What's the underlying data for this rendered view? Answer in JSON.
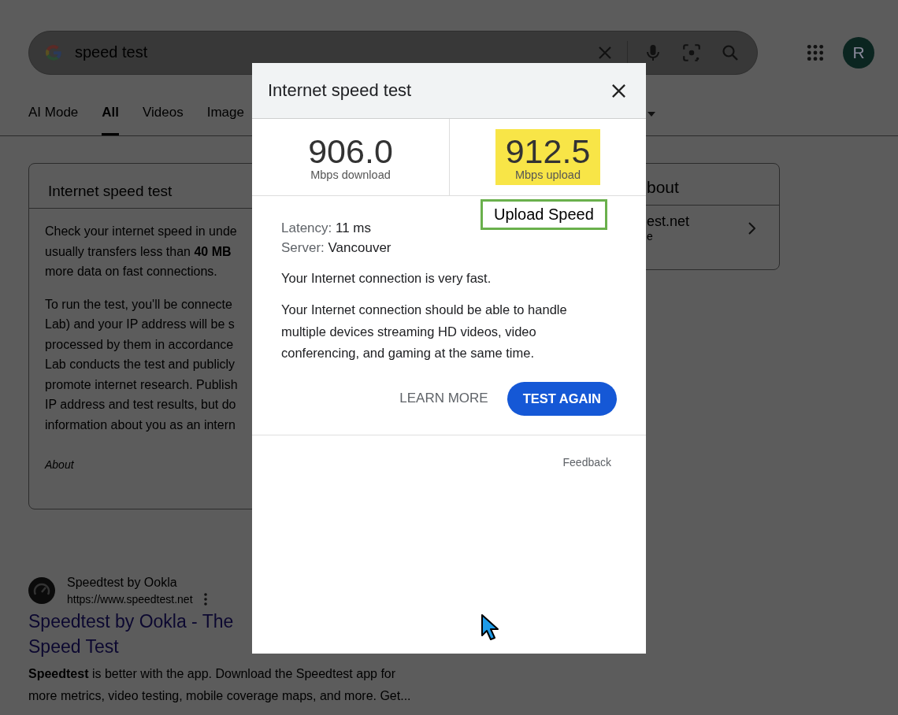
{
  "search": {
    "query": "speed test"
  },
  "avatar": {
    "initial": "R"
  },
  "tabs": [
    {
      "label": "AI Mode",
      "selected": false
    },
    {
      "label": "All",
      "selected": true
    },
    {
      "label": "Videos",
      "selected": false
    },
    {
      "label": "Image",
      "selected": false
    }
  ],
  "info_card": {
    "title": "Internet speed test",
    "paragraphs": [
      [
        "Check your internet speed in unde",
        "usually transfers less than **40 MB**",
        "more data on fast connections."
      ],
      [
        "To run the test, you'll be connecte",
        "Lab) and your IP address will be s",
        "processed by them in accordance",
        "Lab conducts the test and publicly",
        "promote internet research. Publish",
        "IP address and test results, but do",
        "information about you as an intern"
      ]
    ],
    "about": "About"
  },
  "result": {
    "site": "Speedtest by Ookla",
    "url": "https://www.speedtest.net",
    "title_lines": [
      "Speedtest by Ookla - The",
      "Speed Test"
    ],
    "snippet_lines": [
      "**Speedtest** is better with the app. Download the Speedtest app for",
      "more metrics, video testing, mobile coverage maps, and more. Get..."
    ]
  },
  "side_card": {
    "title": "bout",
    "link_lines": [
      "est.net",
      "e"
    ]
  },
  "dialog": {
    "title": "Internet speed test",
    "stats": [
      {
        "value": "906.0",
        "label": "Mbps download",
        "highlighted": false
      },
      {
        "value": "912.5",
        "label": "Mbps upload",
        "highlighted": true
      }
    ],
    "details": [
      {
        "label": "Latency:",
        "value": "11 ms"
      },
      {
        "label": "Server:",
        "value": "Vancouver"
      }
    ],
    "summary": "Your Internet connection is very fast.",
    "description": "Your Internet connection should be able to handle multiple devices streaming HD videos, video conferencing, and gaming at the same time.",
    "buttons": [
      {
        "label": "LEARN MORE",
        "kind": "text"
      },
      {
        "label": "TEST AGAIN",
        "kind": "filled"
      }
    ],
    "feedback": "Feedback"
  },
  "callout": {
    "text": "Upload Speed"
  }
}
